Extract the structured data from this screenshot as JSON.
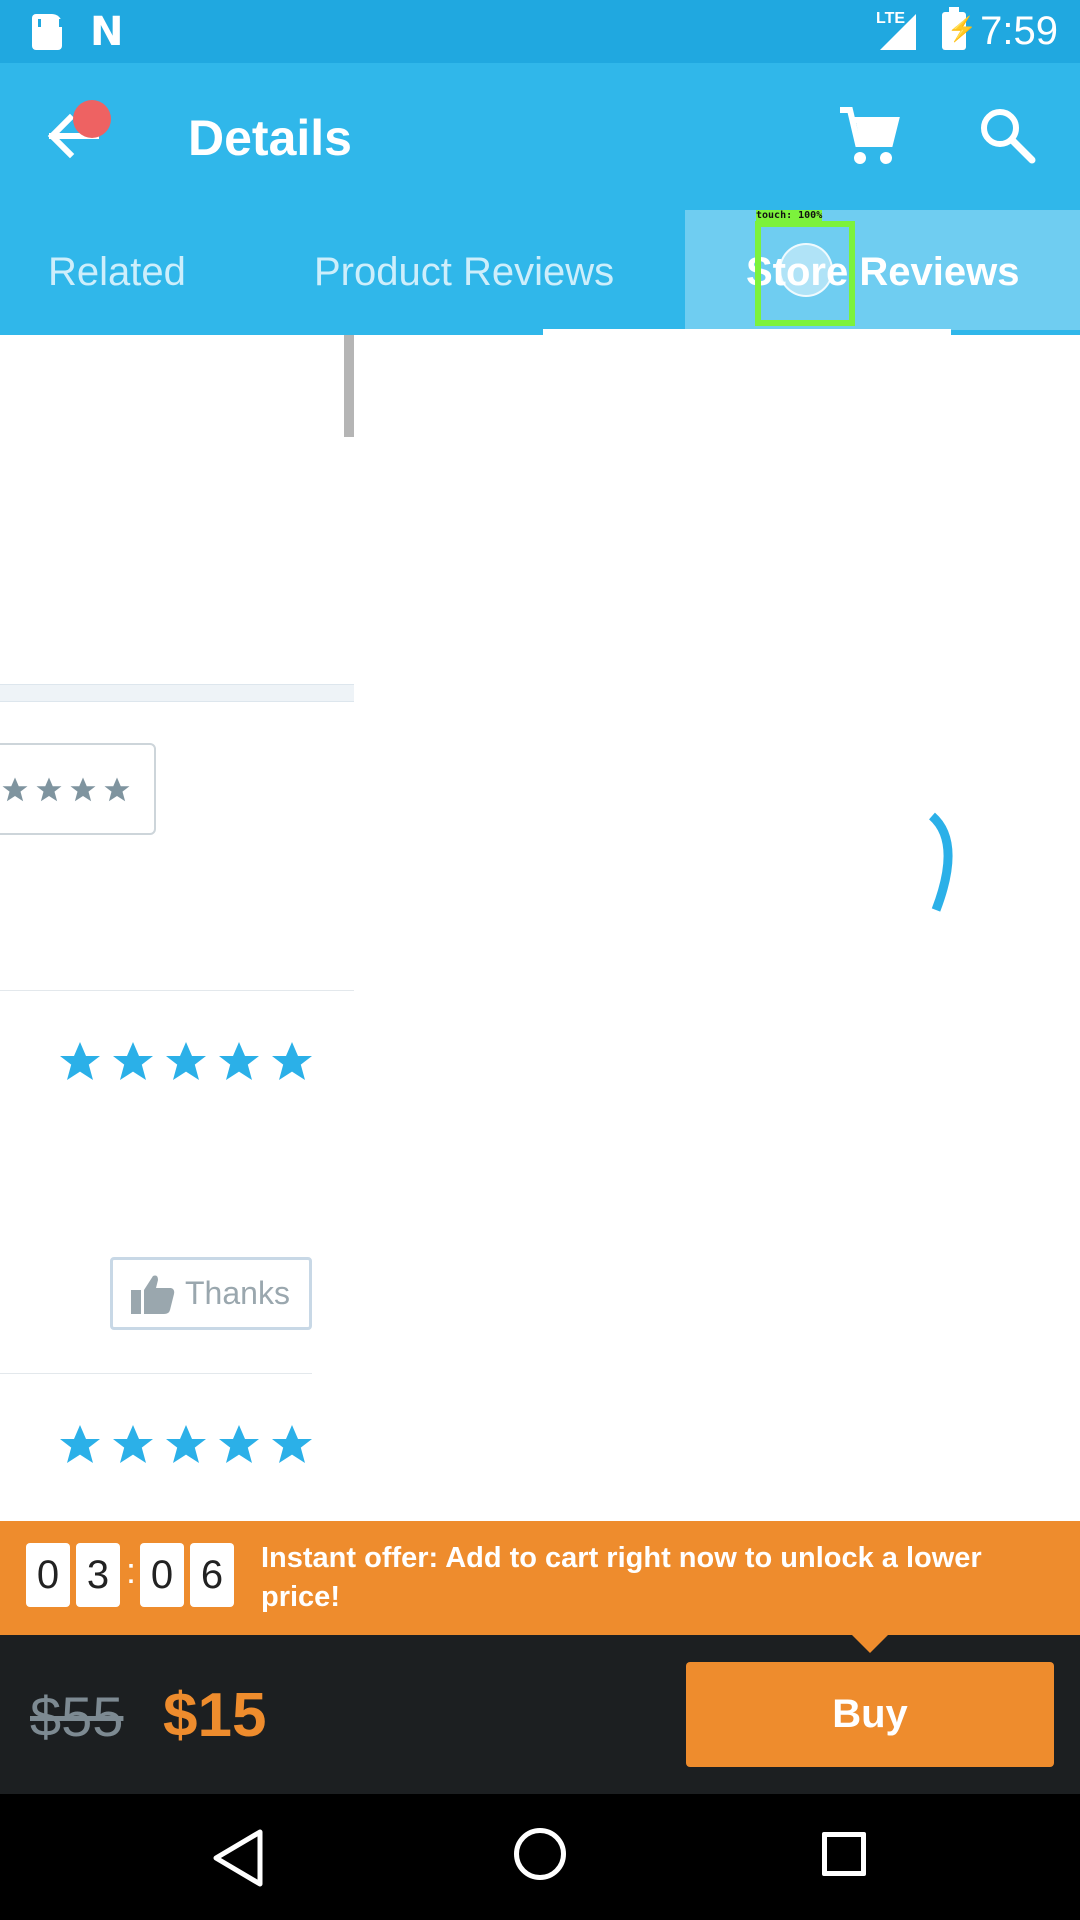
{
  "status_bar": {
    "network": "LTE",
    "time": "7:59"
  },
  "app_bar": {
    "title": "Details"
  },
  "tabs": [
    {
      "label": "Related",
      "selected": false
    },
    {
      "label": "Product Reviews",
      "selected": false
    },
    {
      "label": "Store Reviews",
      "selected": true
    }
  ],
  "overlay": {
    "touch_label": "touch: 100%"
  },
  "reviews": {
    "rating_filter_stars": 4,
    "review_rows": [
      {
        "stars": 5
      },
      {
        "stars": 5
      }
    ],
    "thanks_label": "Thanks"
  },
  "offer": {
    "timer_digits": [
      "0",
      "3",
      "0",
      "6"
    ],
    "separator": ":",
    "text": "Instant offer: Add to cart right now to unlock a lower price!"
  },
  "purchase": {
    "old_price": "$55",
    "new_price": "$15",
    "buy_label": "Buy"
  },
  "colors": {
    "accent_blue": "#30b7ea",
    "offer_orange": "#ee8c2d",
    "star_blue": "#2bb0e8"
  }
}
